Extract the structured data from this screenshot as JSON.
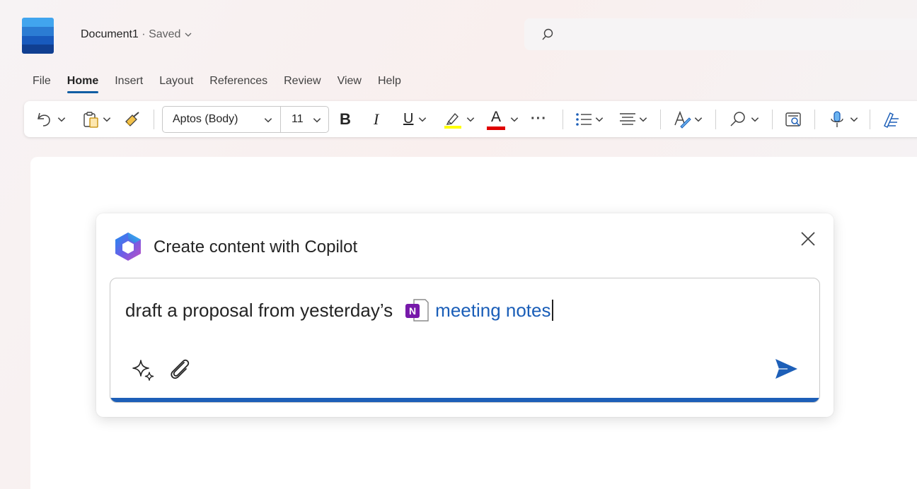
{
  "app": {
    "doc_name": "Document1",
    "separator": "·",
    "status": "Saved",
    "brand_color": "#185abd"
  },
  "search": {
    "placeholder": ""
  },
  "menu": {
    "items": [
      "File",
      "Home",
      "Insert",
      "Layout",
      "References",
      "Review",
      "View",
      "Help"
    ],
    "active": "Home"
  },
  "ribbon": {
    "font_name": "Aptos (Body)",
    "font_size": "11",
    "bold_label": "B",
    "italic_label": "I",
    "underline_label": "U",
    "font_color_label": "A",
    "more_label": "···",
    "highlight_color": "#ffff00",
    "font_color": "#e00000"
  },
  "copilot": {
    "title": "Create content with Copilot",
    "prompt_text": "draft a proposal from yesterday’s",
    "mention_text": "meeting notes",
    "onenote_letter": "N",
    "accent_color": "#1d5fb8"
  }
}
